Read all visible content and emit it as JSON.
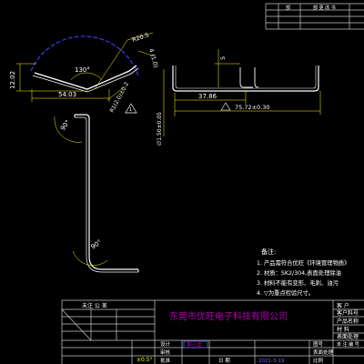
{
  "colors": {
    "background": "#000000",
    "part_line": "#ffffff",
    "dimension": "#ffff00",
    "frame": "#c8c8c8",
    "blue_arc": "#3a3af0",
    "company_text": "#b400b4",
    "highlight": "#5a5ad0",
    "date_text": "#6a6af0"
  },
  "top_right_table": {
    "col_a": "部",
    "col_b": "部 更 改 书"
  },
  "dimensions": {
    "angle_130": "130°",
    "radius_top": "R20.5",
    "thick_label": "4 (1.0)",
    "height_1202": "12.02",
    "width_5403": "54.03",
    "radius_bend": "R1(2.0)±0.2",
    "flatness": "1",
    "thickness": "∅1.50±0.05",
    "ang_90_left": "90°",
    "ang_90_bottom": "90°",
    "side_5": "5",
    "width_3786": "37.86",
    "total_length": "75.72±0.30"
  },
  "notes": {
    "title": "备注:",
    "lines": [
      "1. 产品需符合优旺《环境管理物质》",
      "2. 材质：SK2/304,表面处理除油",
      "3. 材料不能有变形、毛刺、油污",
      "4. ▽为重点检验尺寸。"
    ]
  },
  "title_block": {
    "company": "东莞市优旺电子科技有限公司",
    "tolerance_header": "未注 公 差",
    "tol_angle": "±0.5°",
    "label_design": "设计",
    "label_check": "审核",
    "label_approve": "批准",
    "label_date": "日 期",
    "designer": "李小龙",
    "date_value": "2021-3-19",
    "drawing_no_label": "图号",
    "surface_label": "表面处理",
    "scale_label": "比例 ",
    "right_labels": [
      "客 户",
      "客户料号",
      "产品名称",
      "材 料",
      "表面处理",
      "未 注 编 号"
    ]
  }
}
